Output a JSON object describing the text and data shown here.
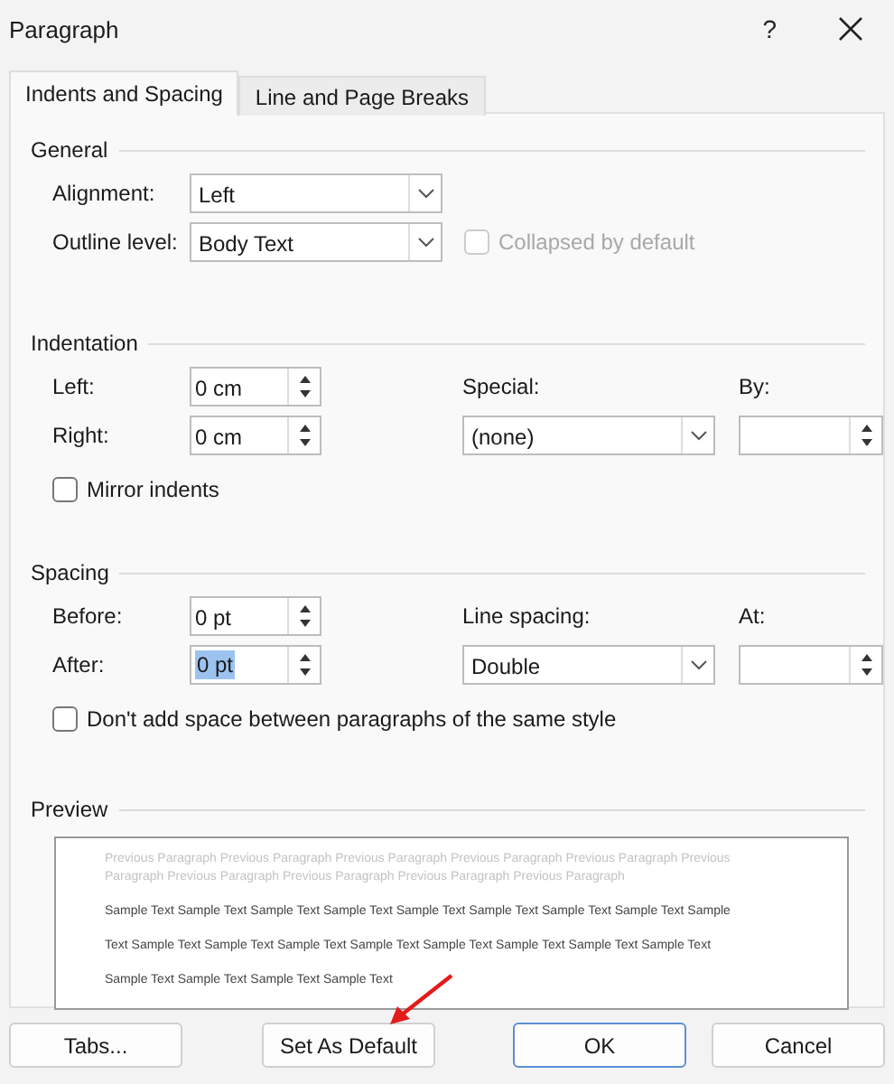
{
  "window": {
    "title": "Paragraph",
    "help": "?"
  },
  "tabs": [
    {
      "label": "Indents and Spacing",
      "selected": true
    },
    {
      "label": "Line and Page Breaks",
      "selected": false
    }
  ],
  "general": {
    "heading": "General",
    "alignment": {
      "label": "Alignment:",
      "value": "Left"
    },
    "outline_level": {
      "label": "Outline level:",
      "value": "Body Text"
    },
    "collapsed": {
      "label": "Collapsed by default",
      "checked": false,
      "disabled": true
    }
  },
  "indentation": {
    "heading": "Indentation",
    "left": {
      "label": "Left:",
      "value": "0 cm",
      "text_selected": false
    },
    "right": {
      "label": "Right:",
      "value": "0 cm",
      "text_selected": false
    },
    "special": {
      "label": "Special:",
      "value": "(none)"
    },
    "by": {
      "label": "By:"
    },
    "mirror": {
      "label": "Mirror indents",
      "checked": false,
      "disabled": false
    }
  },
  "spacing": {
    "heading": "Spacing",
    "before": {
      "label": "Before:",
      "value": "0 pt",
      "text_selected": false
    },
    "after": {
      "label": "After:",
      "value": "0 pt",
      "text_selected": true
    },
    "line_spacing": {
      "label": "Line spacing:",
      "value": "Double"
    },
    "at": {
      "label": "At:"
    },
    "no_space": {
      "label": "Don't add space between paragraphs of the same style",
      "checked": false,
      "disabled": false
    }
  },
  "preview": {
    "heading": "Preview",
    "previous_paragraph": "Previous Paragraph Previous Paragraph Previous Paragraph Previous Paragraph Previous Paragraph Previous Paragraph Previous Paragraph Previous Paragraph Previous Paragraph Previous Paragraph",
    "sample_lines": [
      "Sample Text Sample Text Sample Text Sample Text Sample Text Sample Text Sample Text Sample Text Sample",
      "Text Sample Text Sample Text Sample Text Sample Text Sample Text Sample Text Sample Text Sample Text",
      "Sample Text Sample Text Sample Text Sample Text"
    ]
  },
  "buttons": [
    {
      "label": "Tabs...",
      "default": false
    },
    {
      "label": "Set As Default",
      "default": false
    },
    {
      "label": "OK",
      "default": true
    },
    {
      "label": "Cancel",
      "default": false
    }
  ]
}
